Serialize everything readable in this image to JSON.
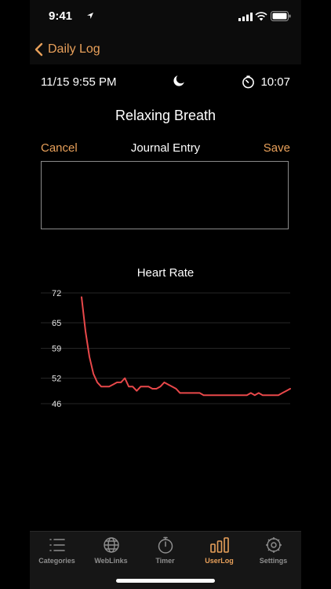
{
  "status": {
    "time": "9:41"
  },
  "nav": {
    "back_label": "Daily Log"
  },
  "session": {
    "datetime": "11/15 9:55 PM",
    "duration": "10:07",
    "title": "Relaxing Breath"
  },
  "journal": {
    "cancel_label": "Cancel",
    "title": "Journal Entry",
    "save_label": "Save",
    "value": ""
  },
  "colors": {
    "accent": "#e8a05a",
    "line": "#e8484a"
  },
  "chart_data": {
    "type": "line",
    "title": "Heart Rate",
    "yticks": [
      72,
      65,
      59,
      52,
      46
    ],
    "ylim": [
      46,
      72
    ],
    "grid": true,
    "series": [
      {
        "values": [
          71,
          63,
          57,
          53,
          51,
          50,
          50,
          50,
          50.5,
          51,
          51,
          52,
          50,
          50,
          49,
          50,
          50,
          50,
          49.5,
          49.5,
          50,
          51,
          50.5,
          50,
          49.5,
          48.5,
          48.5,
          48.5,
          48.5,
          48.5,
          48.5,
          48,
          48,
          48,
          48,
          48,
          48,
          48,
          48,
          48,
          48,
          48,
          48,
          48.5,
          48,
          48.5,
          48,
          48,
          48,
          48,
          48,
          48.5,
          49,
          49.5
        ]
      }
    ]
  },
  "tabs": [
    {
      "label": "Categories",
      "icon": "list-icon"
    },
    {
      "label": "WebLinks",
      "icon": "globe-icon"
    },
    {
      "label": "Timer",
      "icon": "stopwatch-icon"
    },
    {
      "label": "UserLog",
      "icon": "bars-icon",
      "active": true
    },
    {
      "label": "Settings",
      "icon": "gear-icon"
    }
  ]
}
